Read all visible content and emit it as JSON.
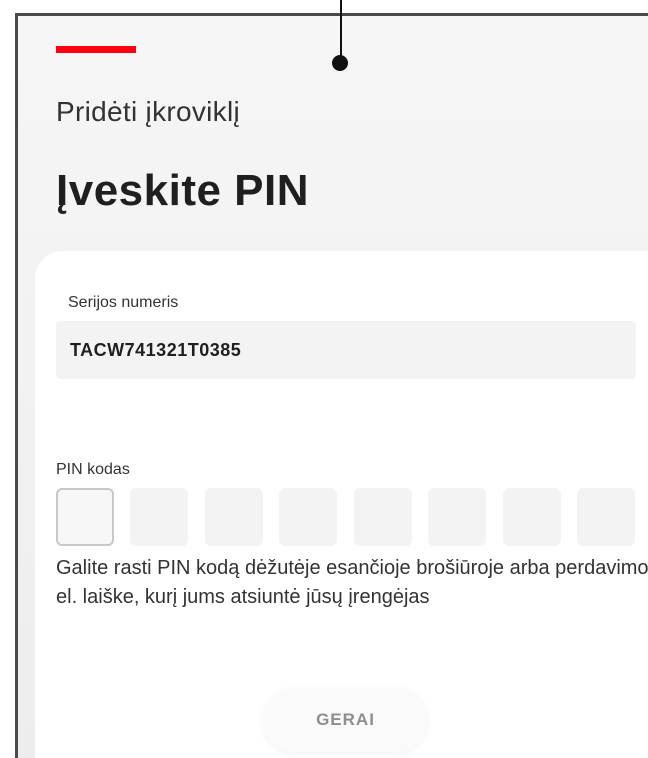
{
  "header": {
    "subtitle": "Pridėti įkroviklį",
    "title": "Įveskite PIN",
    "accent_color": "#ff000f"
  },
  "serial": {
    "label": "Serijos numeris",
    "value": "TACW741321T0385"
  },
  "pin": {
    "label": "PIN kodas",
    "digits": [
      "",
      "",
      "",
      "",
      "",
      "",
      "",
      ""
    ],
    "hint": "Galite rasti PIN kodą dėžutėje esančioje brošiūroje arba perdavimo el. laiške, kurį jums atsiuntė jūsų įrengėjas"
  },
  "actions": {
    "ok_label": "GERAI"
  }
}
